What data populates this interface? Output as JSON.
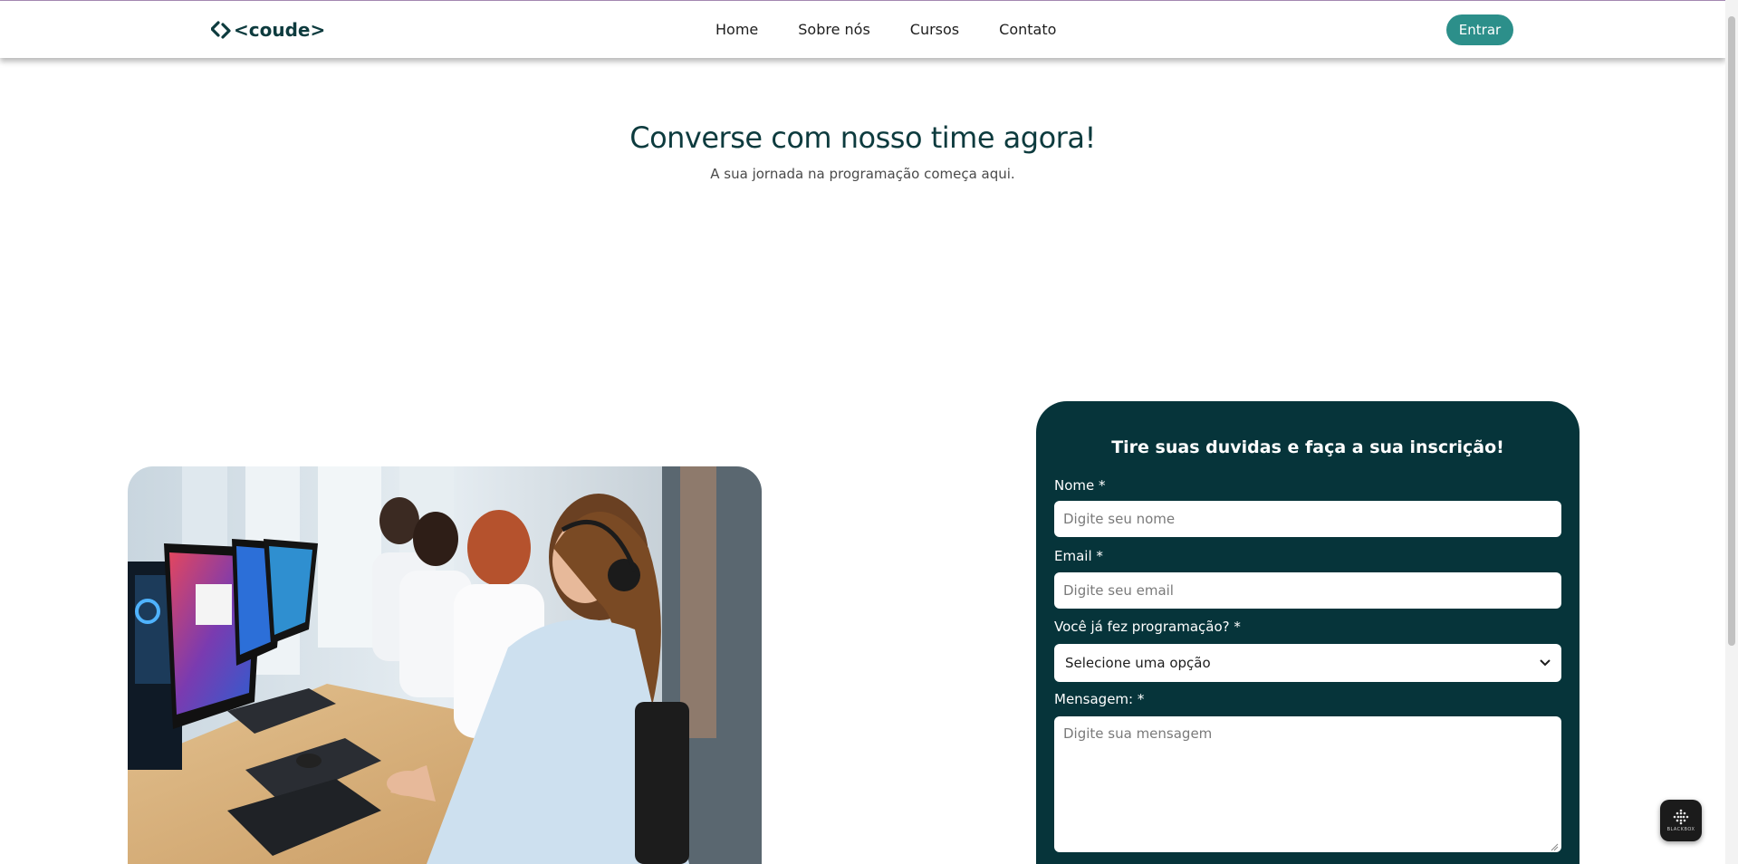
{
  "header": {
    "logo_text": "<coude>",
    "nav": [
      {
        "label": "Home"
      },
      {
        "label": "Sobre nós"
      },
      {
        "label": "Cursos"
      },
      {
        "label": "Contato"
      }
    ],
    "login_label": "Entrar"
  },
  "hero": {
    "title": "Converse com nosso time agora!",
    "subtitle": "A sua jornada na programação começa aqui."
  },
  "form": {
    "title": "Tire suas duvidas e faça a sua inscrição!",
    "name_label": "Nome *",
    "name_placeholder": "Digite seu nome",
    "email_label": "Email *",
    "email_placeholder": "Digite seu email",
    "programming_label": "Você já fez programação? *",
    "programming_selected": "Selecione uma opção",
    "message_label": "Mensagem: *",
    "message_placeholder": "Digite sua mensagem"
  },
  "widget": {
    "label": "BLACKBOX",
    "icon": "blackbox-logo-icon"
  },
  "colors": {
    "brand_dark": "#06343a",
    "accent": "#2c8f8a",
    "title_text": "#0d3b3e"
  }
}
